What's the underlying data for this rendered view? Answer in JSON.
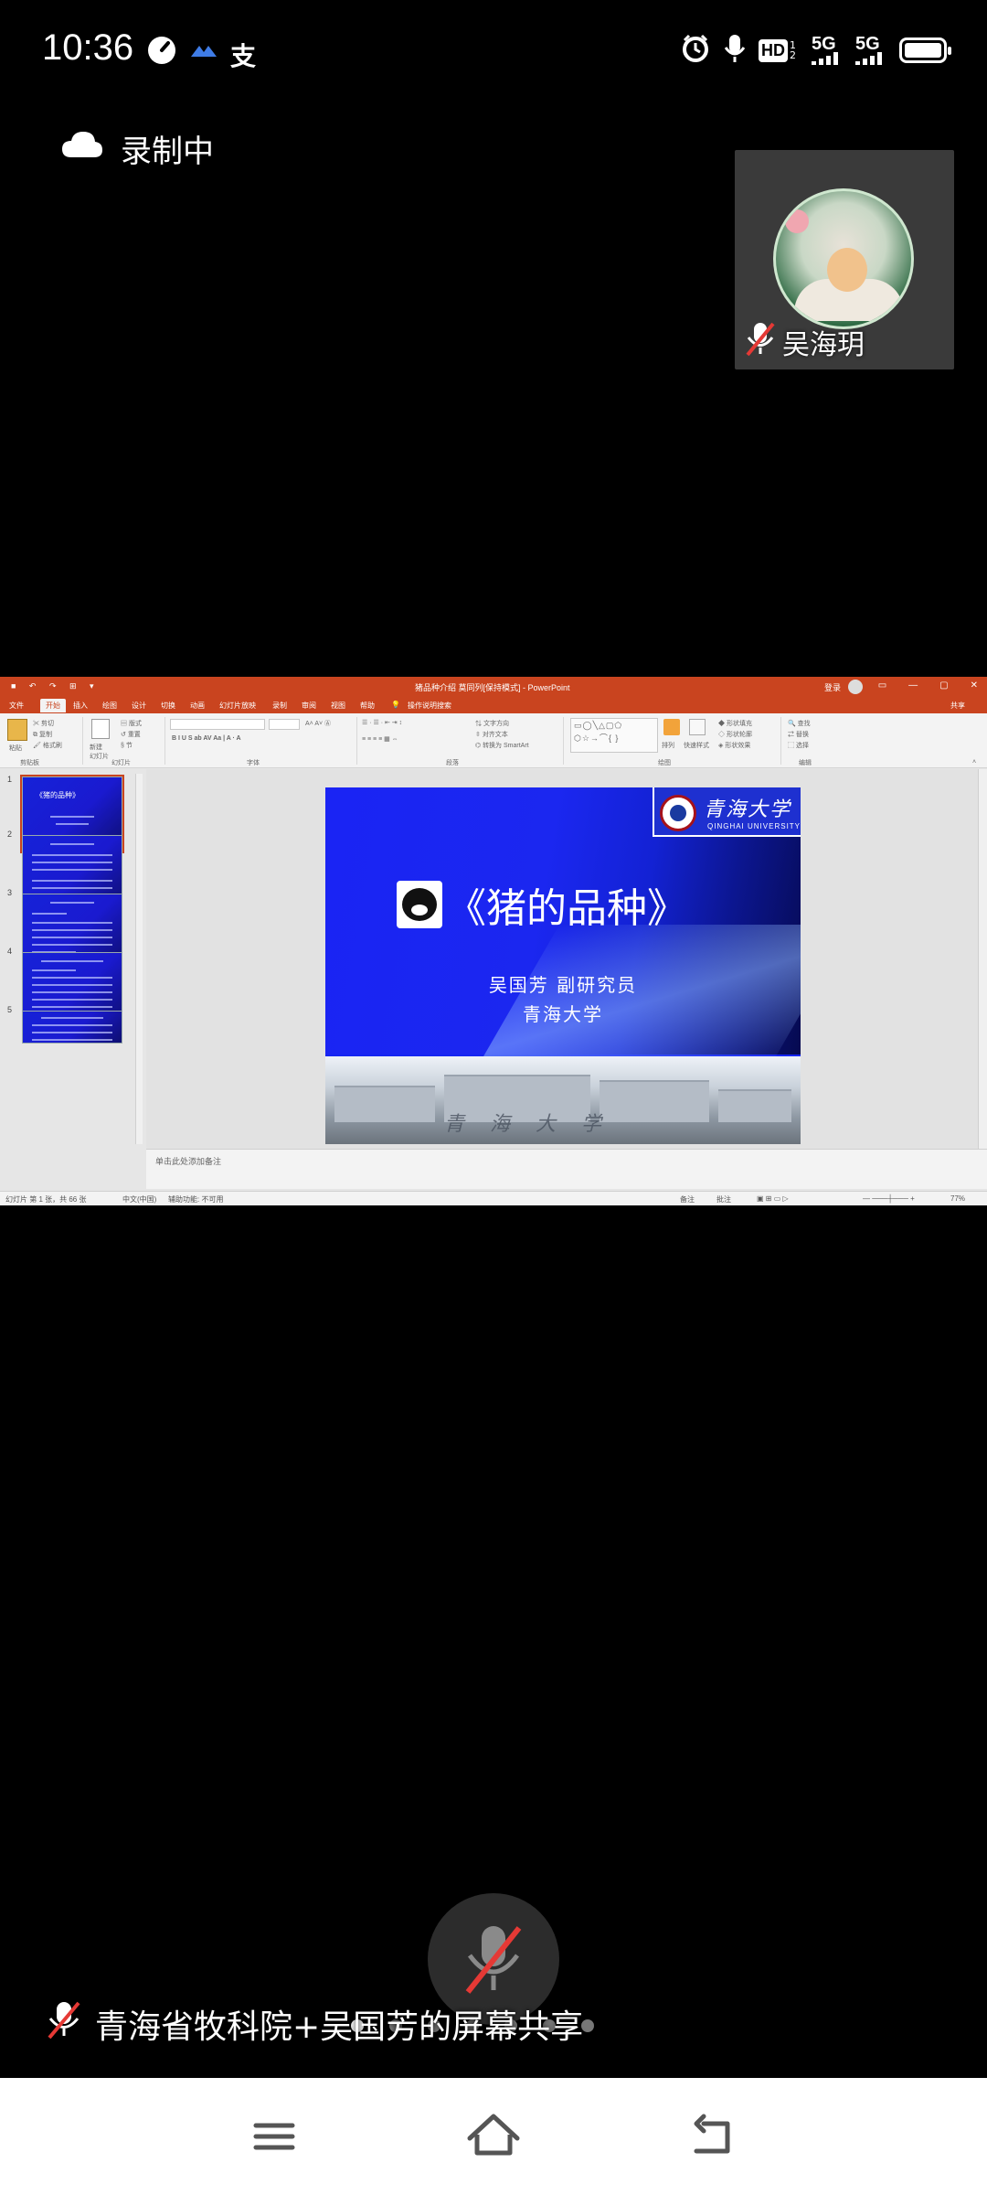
{
  "status_bar": {
    "time": "10:36",
    "zhi_icon_text": "支",
    "hd_label": "HD",
    "hd_sub": "1 2",
    "net1": "5G",
    "net2": "5G",
    "battery_level": 0.85
  },
  "recording": {
    "label": "录制中",
    "icon": "cloud-icon"
  },
  "participant": {
    "name": "吴海玥",
    "muted": true
  },
  "powerpoint": {
    "window_title": "猪品种介绍  莫同列[保持模式] - PowerPoint",
    "login_text": "登录",
    "tabs": [
      "文件",
      "开始",
      "插入",
      "绘图",
      "设计",
      "切换",
      "动画",
      "幻灯片放映",
      "录制",
      "审阅",
      "视图",
      "帮助"
    ],
    "search_hint": "操作说明搜索",
    "share_label": "共享",
    "ribbon_groups": [
      "剪贴板",
      "幻灯片",
      "字体",
      "段落",
      "绘图",
      "编辑"
    ],
    "ribbon_buttons": {
      "paste": "粘贴",
      "new_slide": "新建\n幻灯片",
      "layout": "版式",
      "reset": "重置",
      "section": "节",
      "text_direction": "文字方向",
      "align_text": "对齐文本",
      "smartart": "转换为 SmartArt",
      "arrange": "排列",
      "quick_styles": "快速样式",
      "shape_fill": "形状填充",
      "shape_outline": "形状轮廓",
      "shape_effects": "形状效果",
      "find": "查找",
      "replace": "替换",
      "select": "选择"
    },
    "thumbnails": [
      {
        "num": "1",
        "title": "《猪的品种》"
      },
      {
        "num": "2",
        "title": ""
      },
      {
        "num": "3",
        "title": ""
      },
      {
        "num": "4",
        "title": ""
      },
      {
        "num": "5",
        "title": ""
      }
    ],
    "slide": {
      "logo_cn": "青海大学",
      "logo_en": "QINGHAI UNIVERSITY",
      "title": "《猪的品种》",
      "author": "吴国芳  副研究员",
      "institution": "青海大学",
      "photo_caption": "青海大学"
    },
    "notes_placeholder": "单击此处添加备注",
    "status": {
      "slide_count": "幻灯片 第 1 张，共 66 张",
      "language": "中文(中国)",
      "accessibility": "辅助功能: 不可用",
      "notes_btn": "备注",
      "comments_btn": "批注",
      "zoom": "77%"
    }
  },
  "share_caption": {
    "text": "青海省牧科院+吴国芳的屏幕共享"
  },
  "pager": {
    "count": 7,
    "active_index": 0
  },
  "nav": {
    "buttons": [
      "menu-icon",
      "home-icon",
      "back-icon"
    ]
  },
  "colors": {
    "ppt_accent": "#c9441f",
    "slide_blue": "#1525f2",
    "mute_red": "#e53935"
  }
}
